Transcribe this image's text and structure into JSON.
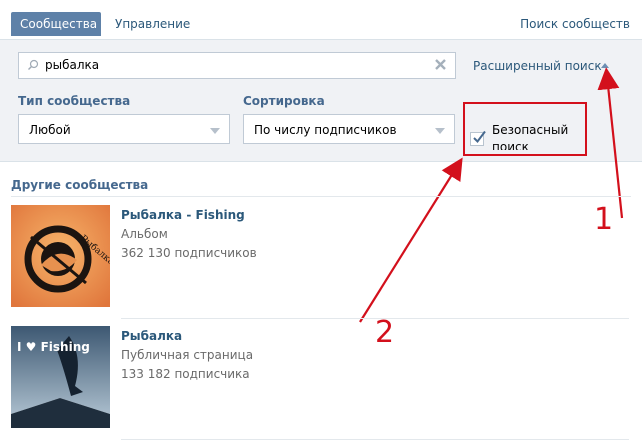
{
  "tabs": {
    "communities": "Сообщества",
    "manage": "Управление",
    "search_communities": "Поиск сообществ"
  },
  "search": {
    "value": "рыбалка",
    "advanced": "Расширенный поиск"
  },
  "filters": {
    "type_label": "Тип сообщества",
    "type_value": "Любой",
    "sort_label": "Сортировка",
    "sort_value": "По числу подписчиков",
    "safe_search": "Безопасный поиск",
    "safe_search_checked": true
  },
  "annotations": {
    "n1": "1",
    "n2": "2",
    "color": "#d3101c"
  },
  "results": {
    "title": "Другие сообщества",
    "items": [
      {
        "name": "Рыбалка - Fishing",
        "kind": "Альбом",
        "subscribers": "362 130 подписчиков",
        "logo_text": "Рыбалка Fishing"
      },
      {
        "name": "Рыбалка",
        "kind": "Публичная страница",
        "subscribers": "133 182 подписчика",
        "logo_text": "I ♥ Fishing"
      }
    ]
  },
  "colors": {
    "accent": "#5e81a8",
    "link": "#2b587a",
    "label": "#45688e"
  }
}
